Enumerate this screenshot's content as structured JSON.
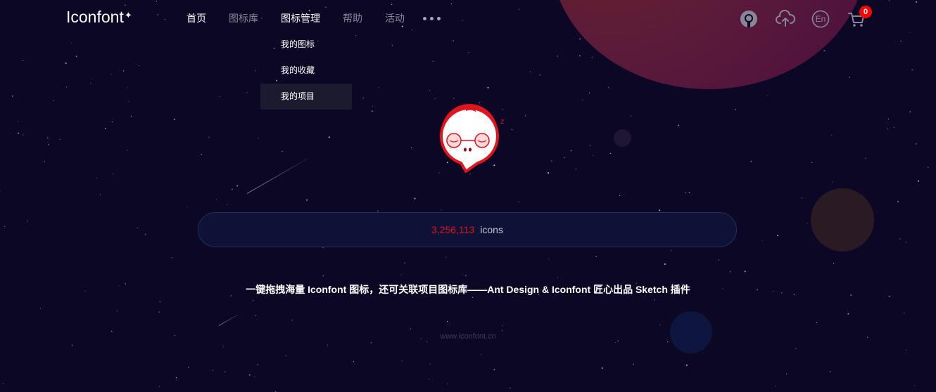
{
  "header": {
    "logo_text": "Iconfont",
    "logo_mark": "✦",
    "nav": [
      {
        "label": "首页"
      },
      {
        "label": "图标库"
      },
      {
        "label": "图标管理"
      },
      {
        "label": "帮助"
      },
      {
        "label": "活动"
      }
    ],
    "more_icon": "more-dots-icon",
    "dropdown": [
      {
        "label": "我的图标"
      },
      {
        "label": "我的收藏"
      },
      {
        "label": "我的项目"
      }
    ],
    "icons": [
      "avatar-icon",
      "upload-icon",
      "language-en-icon",
      "cart-icon"
    ],
    "language_label": "En",
    "cart_count": "0"
  },
  "hero": {
    "icon_count": "3,256,113",
    "icon_count_label": "icons",
    "slogan": "一键拖拽海量 Iconfont 图标，还可关联项目图标库——Ant Design & Iconfont 匠心出品 Sketch 插件",
    "footer_url": "www.iconfont.cn"
  },
  "colors": {
    "background": "#0b0724",
    "accent_red": "#e2141e",
    "badge_red": "#ff0000"
  }
}
